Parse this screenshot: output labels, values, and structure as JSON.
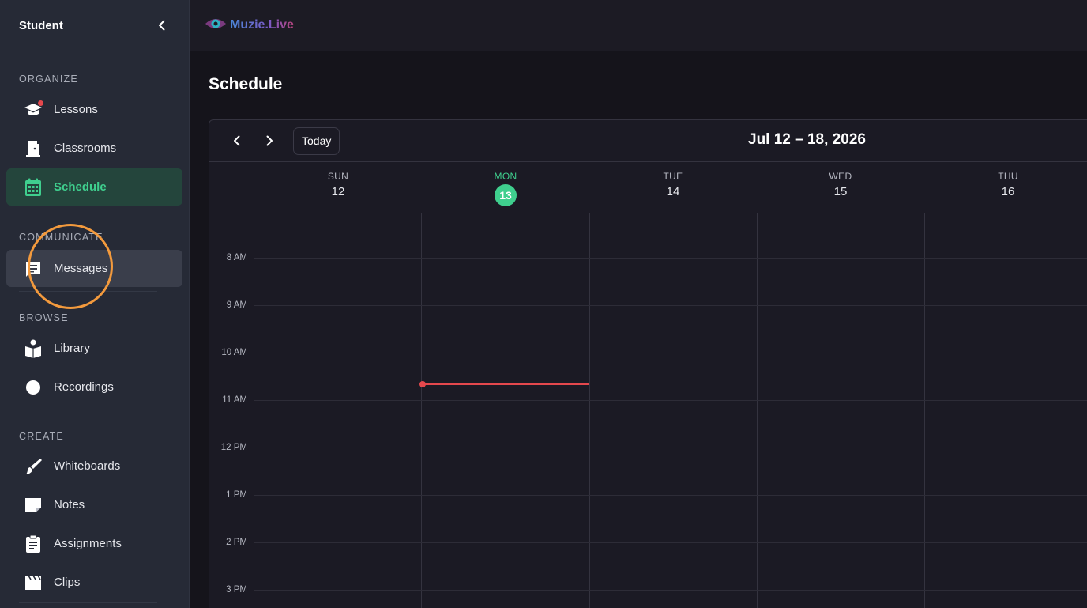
{
  "sidebar": {
    "title": "Student",
    "sections": [
      {
        "label": "ORGANIZE",
        "items": [
          {
            "label": "Lessons",
            "icon": "graduation-cap-icon"
          },
          {
            "label": "Classrooms",
            "icon": "door-icon"
          },
          {
            "label": "Schedule",
            "icon": "calendar-icon"
          }
        ]
      },
      {
        "label": "COMMUNICATE",
        "items": [
          {
            "label": "Messages",
            "icon": "message-icon"
          }
        ]
      },
      {
        "label": "BROWSE",
        "items": [
          {
            "label": "Library",
            "icon": "book-reader-icon"
          },
          {
            "label": "Recordings",
            "icon": "record-icon"
          }
        ]
      },
      {
        "label": "CREATE",
        "items": [
          {
            "label": "Whiteboards",
            "icon": "brush-icon"
          },
          {
            "label": "Notes",
            "icon": "note-icon"
          },
          {
            "label": "Assignments",
            "icon": "clipboard-icon"
          },
          {
            "label": "Clips",
            "icon": "clapperboard-icon"
          }
        ]
      }
    ]
  },
  "topbar": {
    "logo_text": "Muzie.Live"
  },
  "page": {
    "title": "Schedule"
  },
  "calendar": {
    "today_label": "Today",
    "range_title": "Jul 12 – 18, 2026",
    "days": [
      {
        "name": "SUN",
        "num": "12"
      },
      {
        "name": "MON",
        "num": "13"
      },
      {
        "name": "TUE",
        "num": "14"
      },
      {
        "name": "WED",
        "num": "15"
      },
      {
        "name": "THU",
        "num": "16"
      }
    ],
    "times": [
      "8 AM",
      "9 AM",
      "10 AM",
      "11 AM",
      "12 PM",
      "1 PM",
      "2 PM",
      "3 PM"
    ]
  },
  "colors": {
    "accent": "#3fcf8e",
    "now_indicator": "#e5484d",
    "highlight_ring": "#f39a3d"
  }
}
